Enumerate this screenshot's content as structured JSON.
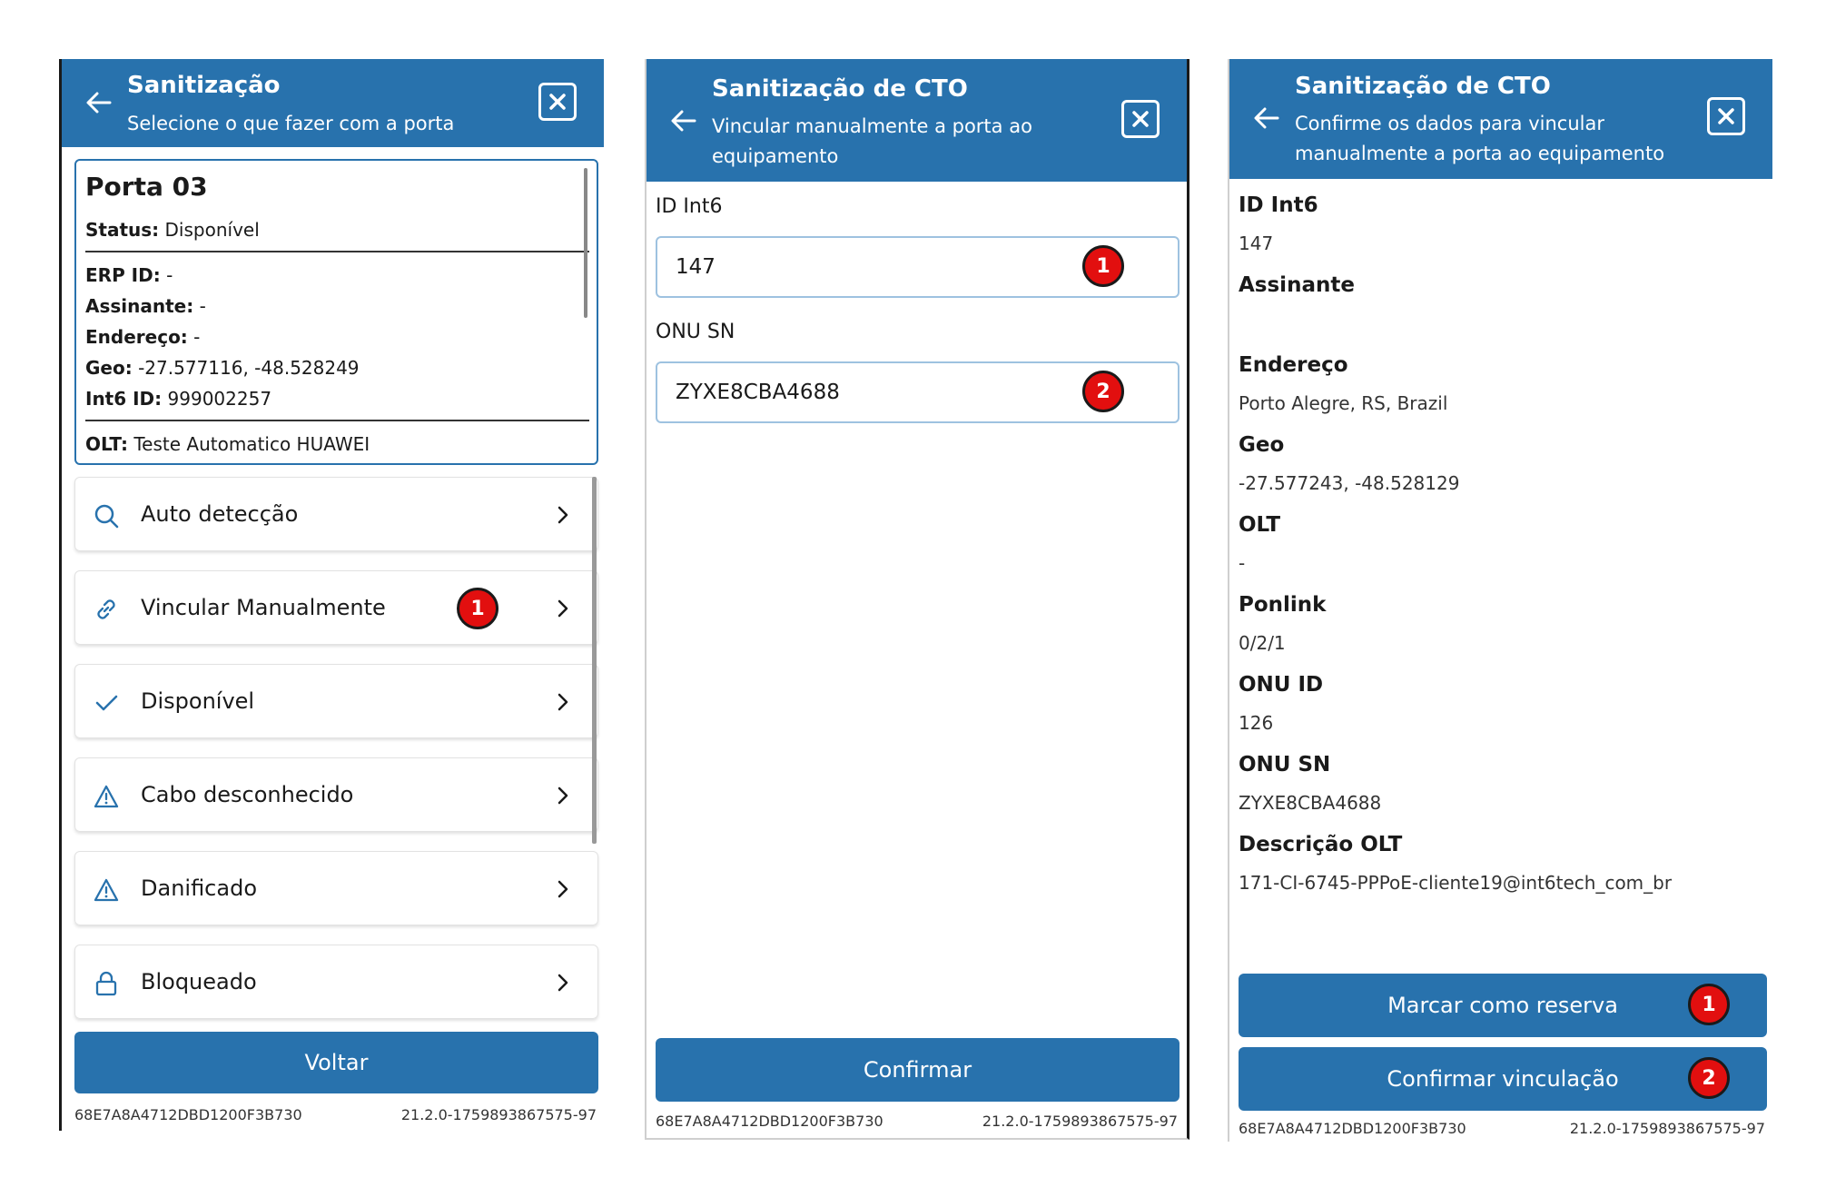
{
  "panel1": {
    "header": {
      "title": "Sanitização",
      "subtitle": "Selecione o que fazer com a porta"
    },
    "card": {
      "title": "Porta 03",
      "status_label": "Status:",
      "status_value": "Disponível",
      "erp_label": "ERP ID:",
      "erp_value": "-",
      "assinante_label": "Assinante:",
      "assinante_value": "-",
      "endereco_label": "Endereço:",
      "endereco_value": "-",
      "geo_label": "Geo:",
      "geo_value": "-27.577116, -48.528249",
      "int6_label": "Int6 ID:",
      "int6_value": "999002257",
      "olt_label": "OLT:",
      "olt_value": "Teste Automatico HUAWEI"
    },
    "menu": [
      {
        "label": "Auto detecção",
        "icon": "search-icon"
      },
      {
        "label": "Vincular Manualmente",
        "icon": "link-icon",
        "badge": "1"
      },
      {
        "label": "Disponível",
        "icon": "check-icon"
      },
      {
        "label": "Cabo desconhecido",
        "icon": "warning-icon"
      },
      {
        "label": "Danificado",
        "icon": "warning-icon"
      },
      {
        "label": "Bloqueado",
        "icon": "lock-icon"
      }
    ],
    "button": "Voltar",
    "footer_left": "68E7A8A4712DBD1200F3B730",
    "footer_right": "21.2.0-1759893867575-97"
  },
  "panel2": {
    "header": {
      "title": "Sanitização de CTO",
      "subtitle": "Vincular manualmente a porta ao equipamento"
    },
    "fields": [
      {
        "label": "ID Int6",
        "value": "147",
        "badge": "1"
      },
      {
        "label": "ONU SN",
        "value": "ZYXE8CBA4688",
        "badge": "2"
      }
    ],
    "button": "Confirmar",
    "footer_left": "68E7A8A4712DBD1200F3B730",
    "footer_right": "21.2.0-1759893867575-97"
  },
  "panel3": {
    "header": {
      "title": "Sanitização de CTO",
      "subtitle": "Confirme os dados para vincular manualmente a porta ao equipamento"
    },
    "details": [
      {
        "label": "ID Int6",
        "value": "147"
      },
      {
        "label": "Assinante",
        "value": ""
      },
      {
        "label": "Endereço",
        "value": "Porto Alegre, RS, Brazil"
      },
      {
        "label": "Geo",
        "value": "-27.577243, -48.528129"
      },
      {
        "label": "OLT",
        "value": "-"
      },
      {
        "label": "Ponlink",
        "value": "0/2/1"
      },
      {
        "label": "ONU ID",
        "value": "126"
      },
      {
        "label": "ONU SN",
        "value": "ZYXE8CBA4688"
      },
      {
        "label": "Descrição OLT",
        "value": "171-CI-6745-PPPoE-cliente19@int6tech_com_br"
      }
    ],
    "buttons": [
      {
        "label": "Marcar como reserva",
        "badge": "1"
      },
      {
        "label": "Confirmar vinculação",
        "badge": "2"
      }
    ],
    "footer_left": "68E7A8A4712DBD1200F3B730",
    "footer_right": "21.2.0-1759893867575-97"
  },
  "colors": {
    "primary": "#2872ad",
    "badge": "#e20f0f",
    "input_border": "#9ec2e0"
  }
}
